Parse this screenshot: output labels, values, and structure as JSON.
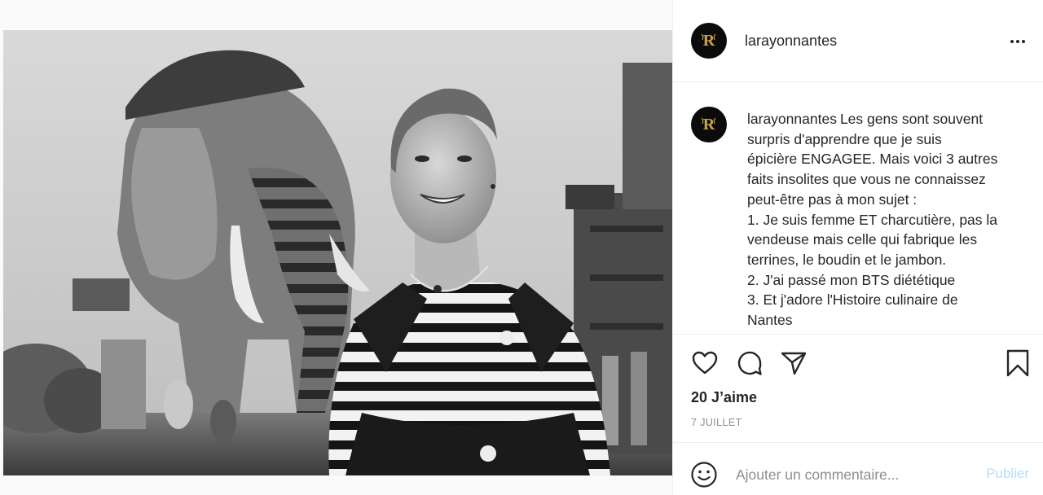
{
  "post": {
    "username": "larayonnantes",
    "avatar_letter": "R",
    "photo_description_icon": "post-photo",
    "caption": {
      "username": "larayonnantes",
      "lines": [
        "Les gens sont souvent",
        "surpris d'apprendre que je suis",
        "épicière ENGAGEE. Mais voici 3 autres",
        "faits insolites que vous ne connaissez",
        "peut-être pas à mon sujet :",
        "1. Je suis femme ET charcutière, pas la",
        "vendeuse mais celle qui fabrique les",
        "terrines, le boudin et le jambon.",
        "2. J'ai passé mon BTS diététique",
        "3. Et j'adore l'Histoire culinaire de",
        "Nantes"
      ]
    },
    "likes_text": "20 J’aime",
    "date_text": "7 juillet"
  },
  "comment_box": {
    "placeholder": "Ajouter un commentaire...",
    "value": "",
    "publish_label": "Publier"
  },
  "icons": {
    "more": "more-options-icon",
    "like": "heart-icon",
    "comment": "comment-bubble-icon",
    "share": "paper-plane-icon",
    "save": "bookmark-icon",
    "emoji": "emoji-smiley-icon"
  },
  "colors": {
    "text": "#262626",
    "muted": "#8e8e8e",
    "divider": "#efefef",
    "publish_disabled": "#b2dffc",
    "avatar_bg": "#0b0b0b",
    "avatar_gold": "#c9a449"
  }
}
